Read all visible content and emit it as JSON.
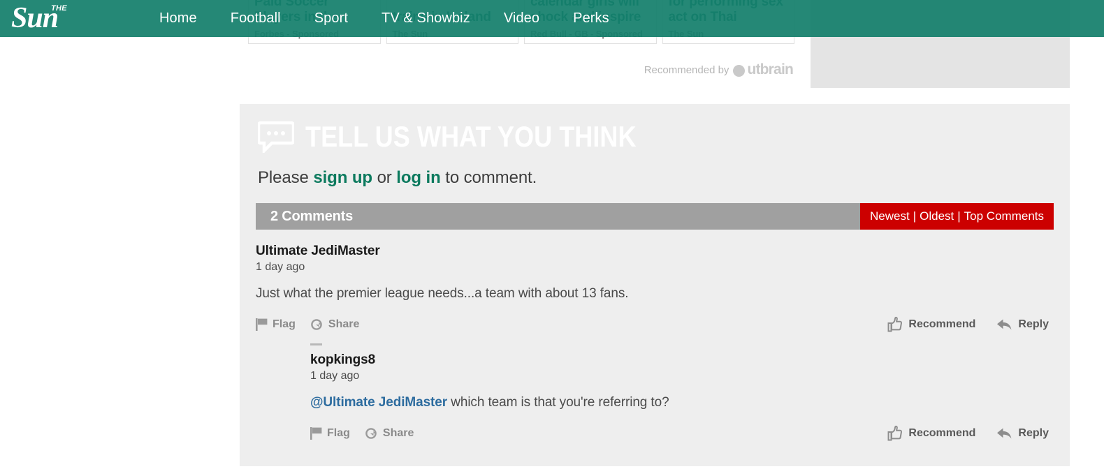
{
  "colors": {
    "brand_teal": "#147F6C",
    "panel_grey": "#EEEEEE",
    "bar_grey": "#A0A0A0",
    "sort_red": "#CC0000",
    "link_green": "#0C7A5E",
    "mention_blue": "#2D6C9F",
    "card_title_teal": "#17796A",
    "ad_placeholder_grey": "#E4E4E4"
  },
  "header": {
    "logo": {
      "word": "Sun",
      "kicker": "THE",
      "icon": "the-sun-logo"
    },
    "nav": [
      {
        "label": "Home"
      },
      {
        "label": "Football"
      },
      {
        "label": "Sport"
      },
      {
        "label": "TV & Showbiz"
      },
      {
        "label": "Video"
      },
      {
        "label": "Perks"
      }
    ]
  },
  "outbrain": {
    "credit_text": "Recommended by",
    "brand": "utbrain",
    "brand_icon": "outbrain-logo-mark",
    "cards": [
      {
        "title": "Paid Soccer Players in the",
        "source": "Forbes - Sponsored"
      },
      {
        "title": "trains in Iceland",
        "source": "The Sun"
      },
      {
        "title": "calendar girls will shock and inspire",
        "source": "Red Bull - GB - Sponsored"
      },
      {
        "title": "for performing sex act on Thai",
        "source": "The Sun"
      }
    ]
  },
  "comments_section": {
    "heading": "TELL US WHAT YOU THINK",
    "heading_icon": "speech-bubble-icon",
    "prompt": {
      "before": "Please ",
      "signup_label": "sign up",
      "middle": " or ",
      "login_label": "log in",
      "after": " to comment."
    },
    "count_label": "2 Comments",
    "sort": {
      "newest": "Newest",
      "oldest": "Oldest",
      "top": "Top Comments",
      "separator": "|"
    },
    "action_labels": {
      "flag": "Flag",
      "share": "Share",
      "recommend": "Recommend",
      "reply": "Reply"
    },
    "action_icons": {
      "flag": "flag-icon",
      "share": "share-icon",
      "recommend": "thumbs-up-icon",
      "reply": "reply-arrow-icon"
    },
    "threads": [
      {
        "author": "Ultimate JediMaster",
        "time": "1 day ago",
        "body_text": "Just what the premier league needs...a team with about 13 fans.",
        "mention": "",
        "replies": [
          {
            "author": "kopkings8",
            "time": "1 day ago",
            "mention": "@Ultimate JediMaster",
            "body_text": " which team is that you're referring to?"
          }
        ]
      }
    ]
  }
}
